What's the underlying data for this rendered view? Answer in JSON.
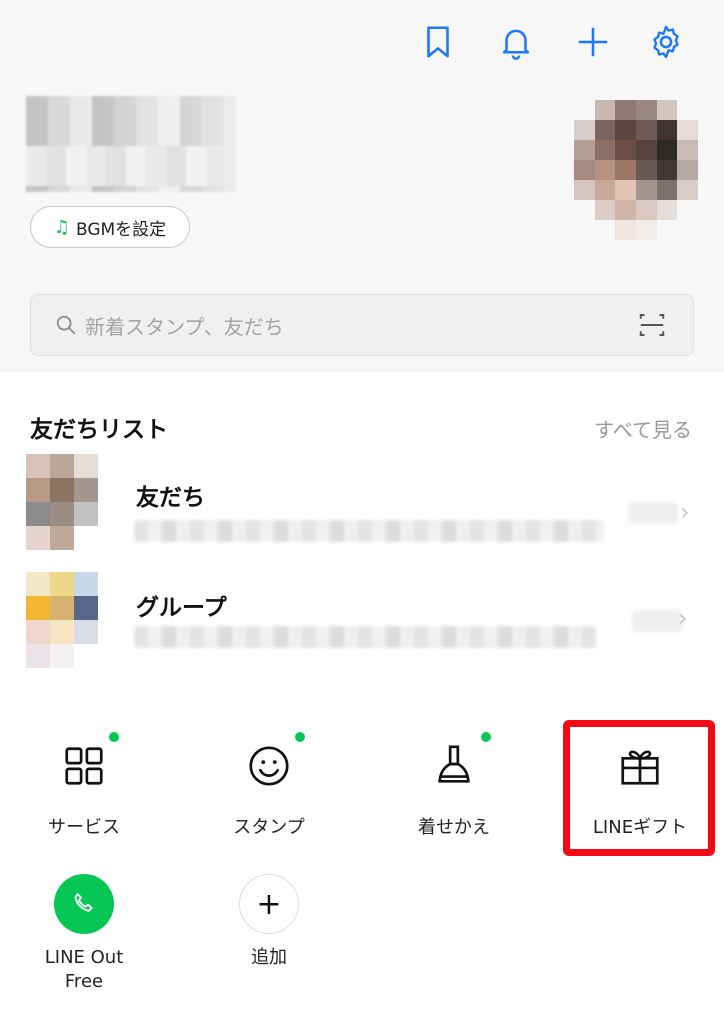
{
  "header": {
    "icons": [
      "bookmark-icon",
      "bell-icon",
      "plus-icon",
      "gear-icon"
    ]
  },
  "profile": {
    "bgm_label": "BGMを設定",
    "bgm_icon": "music-note-icon"
  },
  "search": {
    "placeholder": "新着スタンプ、友だち"
  },
  "friends_section": {
    "title": "友だちリスト",
    "see_all": "すべて見る",
    "rows": [
      {
        "title": "友だち"
      },
      {
        "title": "グループ"
      }
    ]
  },
  "services": {
    "items": [
      {
        "label": "サービス",
        "icon": "grid-icon",
        "new": true
      },
      {
        "label": "スタンプ",
        "icon": "smile-icon",
        "new": true
      },
      {
        "label": "着せかえ",
        "icon": "brush-icon",
        "new": true
      },
      {
        "label": "LINEギフト",
        "icon": "gift-icon",
        "new": false,
        "highlighted": true
      },
      {
        "label": "LINE Out Free",
        "icon": "phone-icon"
      },
      {
        "label": "追加",
        "icon": "plus-icon"
      }
    ],
    "lineout_label_line1": "LINE Out",
    "lineout_label_line2": "Free"
  },
  "colors": {
    "accent_blue": "#1a78ff",
    "line_green": "#06c755",
    "highlight_red": "#f20a14"
  }
}
